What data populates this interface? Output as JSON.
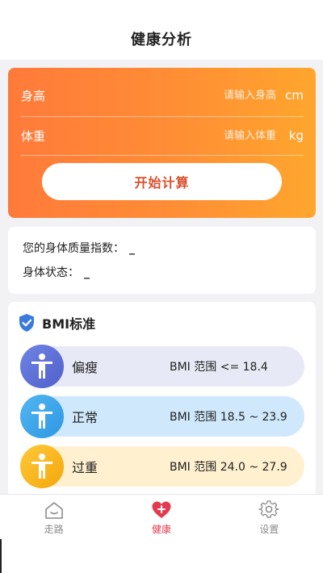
{
  "header": {
    "title": "健康分析"
  },
  "form": {
    "height": {
      "label": "身高",
      "placeholder": "请输入身高",
      "unit": "cm"
    },
    "weight": {
      "label": "体重",
      "placeholder": "请输入体重",
      "unit": "kg"
    },
    "calc_button": "开始计算"
  },
  "result": {
    "bmi_label": "您的身体质量指数：",
    "bmi_value": "_",
    "status_label": "身体状态：",
    "status_value": "_"
  },
  "standards": {
    "title": "BMI标准",
    "items": [
      {
        "name": "偏瘦",
        "range": "BMI 范围 <= 18.4",
        "color": "#5c6fd6",
        "icon": "person-icon"
      },
      {
        "name": "正常",
        "range": "BMI 范围 18.5 ~ 23.9",
        "color": "#3aa6ee",
        "icon": "person-icon"
      },
      {
        "name": "过重",
        "range": "BMI 范围 24.0 ~ 27.9",
        "color": "#f9b51c",
        "icon": "person-icon"
      }
    ]
  },
  "tabbar": {
    "items": [
      {
        "label": "走路",
        "icon": "home-walk-icon"
      },
      {
        "label": "健康",
        "icon": "heart-plus-icon",
        "active": true
      },
      {
        "label": "设置",
        "icon": "gear-icon"
      }
    ]
  },
  "colors": {
    "accent": "#ff8a36",
    "active_tab": "#e33a4f"
  }
}
